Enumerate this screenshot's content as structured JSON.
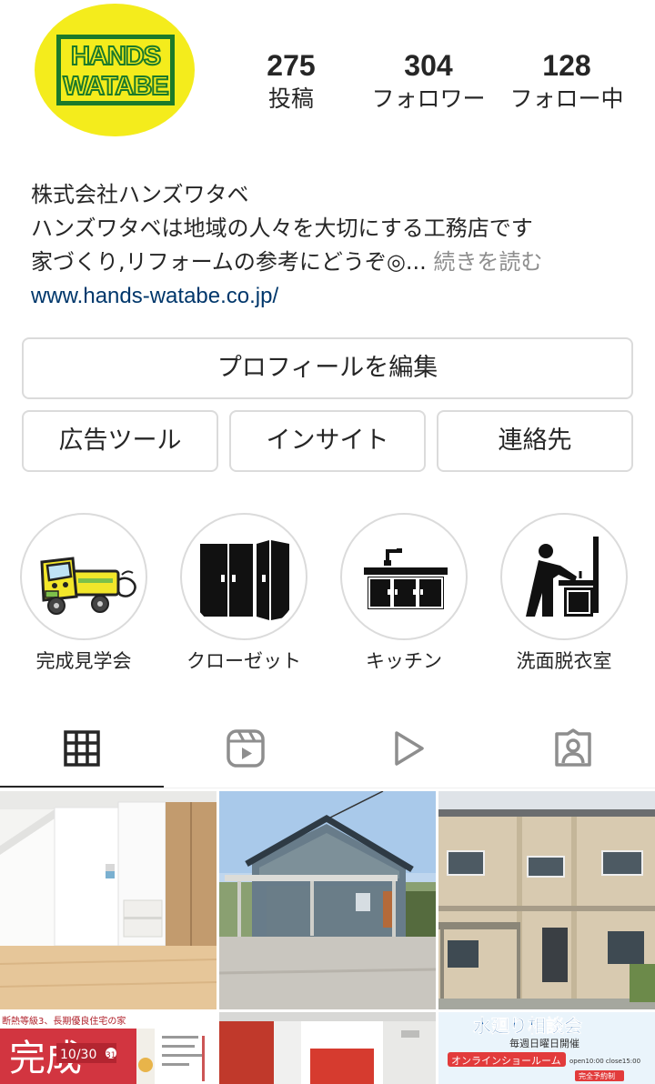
{
  "profile": {
    "logo_line1": "HANDS",
    "logo_line2": "WATABE",
    "stats": {
      "posts_count": "275",
      "posts_label": "投稿",
      "followers_count": "304",
      "followers_label": "フォロワー",
      "following_count": "128",
      "following_label": "フォロー中"
    },
    "bio": {
      "name": "株式会社ハンズワタベ",
      "line1": "ハンズワタベは地域の人々を大切にする工務店です",
      "line2": "家づくり,リフォームの参考にどうぞ◎...",
      "more": "続きを読む",
      "website": "www.hands-watabe.co.jp/"
    }
  },
  "buttons": {
    "edit_profile": "プロフィールを編集",
    "ad_tools": "広告ツール",
    "insights": "インサイト",
    "contact": "連絡先"
  },
  "highlights": [
    {
      "label": "完成見学会",
      "icon": "truck-icon"
    },
    {
      "label": "クローゼット",
      "icon": "closet-icon"
    },
    {
      "label": "キッチン",
      "icon": "kitchen-icon"
    },
    {
      "label": "洗面脱衣室",
      "icon": "washroom-icon"
    }
  ],
  "tabs": [
    {
      "name": "posts-grid",
      "icon": "grid-icon",
      "active": true
    },
    {
      "name": "reels",
      "icon": "reels-icon",
      "active": false
    },
    {
      "name": "videos",
      "icon": "play-icon",
      "active": false
    },
    {
      "name": "tagged",
      "icon": "tagged-person-icon",
      "active": false
    }
  ],
  "posts": {
    "p4_text_badge": "断熱等級3、長期優良住宅の家",
    "p4_big": "完成",
    "p4_date": "10/30",
    "p4_date2": "31",
    "p6_title": "水廻り相談会",
    "p6_sub": "毎週日曜日開催",
    "p6_banner": "オンラインショールーム",
    "p6_time": "open10:00 close15:00",
    "p6_reserve": "完全予約制"
  },
  "colors": {
    "logo_yellow": "#f4ec1c",
    "logo_green": "#1c7a2a",
    "link_blue": "#00376b",
    "muted_gray": "#8e8e8e",
    "border_gray": "#dbdbdb"
  }
}
